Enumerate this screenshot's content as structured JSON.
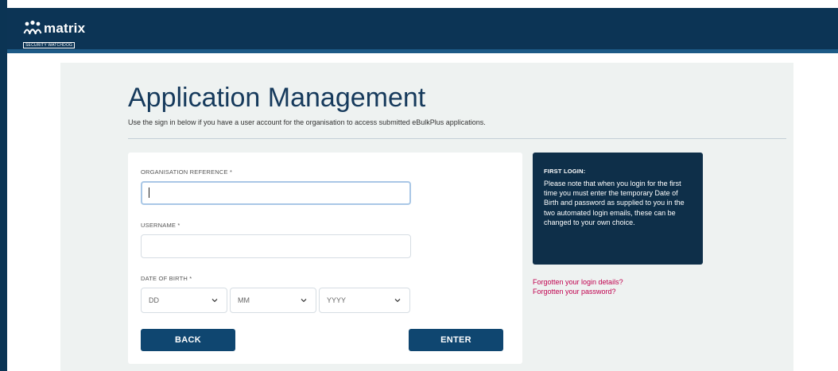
{
  "header": {
    "logo_word": "matrix",
    "logo_tagline": "SECURITY WATCHDOG"
  },
  "main": {
    "title": "Application Management",
    "subtitle": "Use the sign in below if you have a user account for the organisation to access submitted eBulkPlus applications."
  },
  "form": {
    "org_ref_label": "ORGANISATION REFERENCE *",
    "org_ref_value": "",
    "username_label": "USERNAME *",
    "username_value": "",
    "dob_label": "DATE OF BIRTH *",
    "dob_day": "DD",
    "dob_month": "MM",
    "dob_year": "YYYY",
    "back_label": "BACK",
    "enter_label": "ENTER"
  },
  "info": {
    "title": "FIRST LOGIN:",
    "text": "Please note that when you login for the first time you must enter the temporary Date of Birth and password as supplied to you in the two automated login emails, these can be changed to your own choice."
  },
  "links": {
    "forgot_login": "Forgotten your login details?",
    "forgot_password": "Forgotten your password?"
  },
  "colors": {
    "header": "#0c3455",
    "button": "#0f4670",
    "info_box": "#0e2f49",
    "link": "#c0004e",
    "panel": "#eef2f1"
  }
}
